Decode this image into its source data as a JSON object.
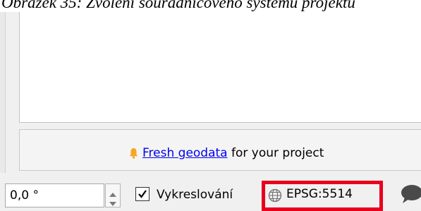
{
  "caption": "Obrázek 35: Zvolení souřadnicového systému projektu",
  "news": {
    "link_text": "Fresh geodata",
    "suffix": " for your project",
    "icon": "bell-icon"
  },
  "status_bar": {
    "rotation_value": "0,0 °",
    "render_checked": true,
    "render_label": "Vykreslování",
    "crs_label": "EPSG:5514",
    "crs_icon": "globe-icon",
    "messages_icon": "speech-bubble-icon"
  },
  "colors": {
    "highlight": "#e8001c",
    "link": "#0000ee",
    "bell": "#f5a623"
  }
}
